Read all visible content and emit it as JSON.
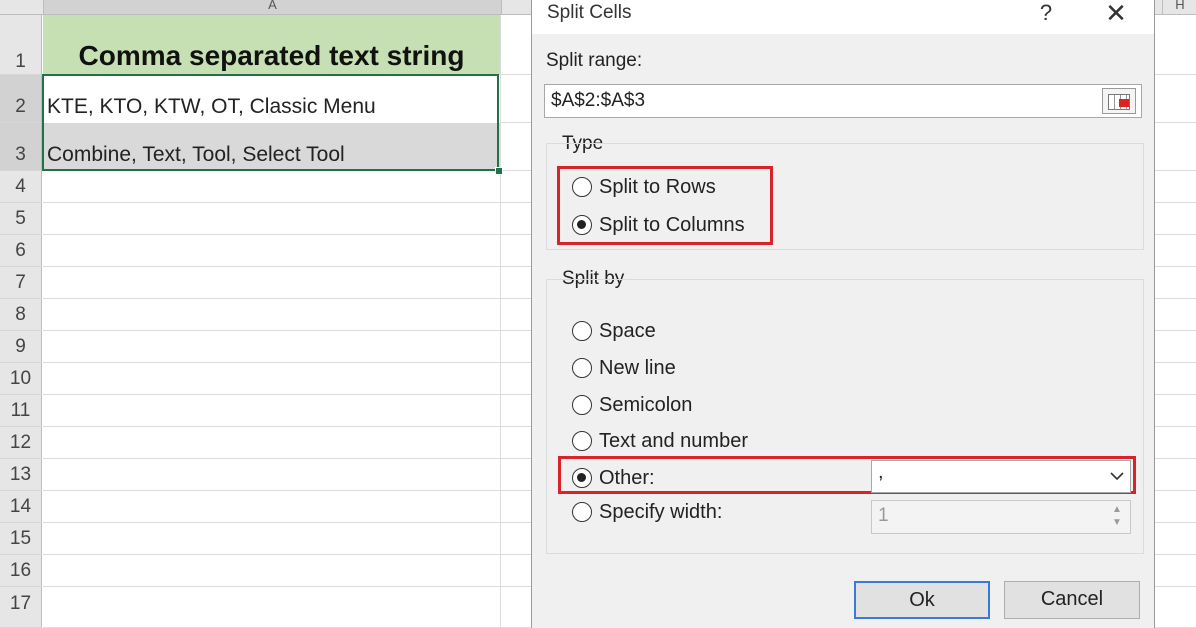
{
  "sheet": {
    "column_a_label": "A",
    "column_h_label": "H",
    "row_numbers": [
      "1",
      "2",
      "3",
      "4",
      "5",
      "6",
      "7",
      "8",
      "9",
      "10",
      "11",
      "12",
      "13",
      "14",
      "15",
      "16",
      "17"
    ],
    "cells": {
      "a1": "Comma separated text string",
      "a2": "KTE, KTO, KTW, OT, Classic Menu",
      "a3": "Combine, Text, Tool, Select Tool"
    }
  },
  "dialog": {
    "title": "Split Cells",
    "help_label": "?",
    "close_label": "✕",
    "split_range_label": "Split range:",
    "split_range_value": "$A$2:$A$3",
    "type_label": "Type",
    "type_options": [
      {
        "label": "Split to Rows",
        "checked": false
      },
      {
        "label": "Split to Columns",
        "checked": true
      }
    ],
    "split_by_label": "Split by",
    "split_by_options": [
      {
        "label": "Space",
        "checked": false
      },
      {
        "label": "New line",
        "checked": false
      },
      {
        "label": "Semicolon",
        "checked": false
      },
      {
        "label": "Text and number",
        "checked": false
      },
      {
        "label": "Other:",
        "checked": true
      },
      {
        "label": "Specify width:",
        "checked": false
      }
    ],
    "other_value": ",",
    "width_value": "1",
    "ok_label": "Ok",
    "cancel_label": "Cancel",
    "highlight_color": "#d8232a"
  }
}
